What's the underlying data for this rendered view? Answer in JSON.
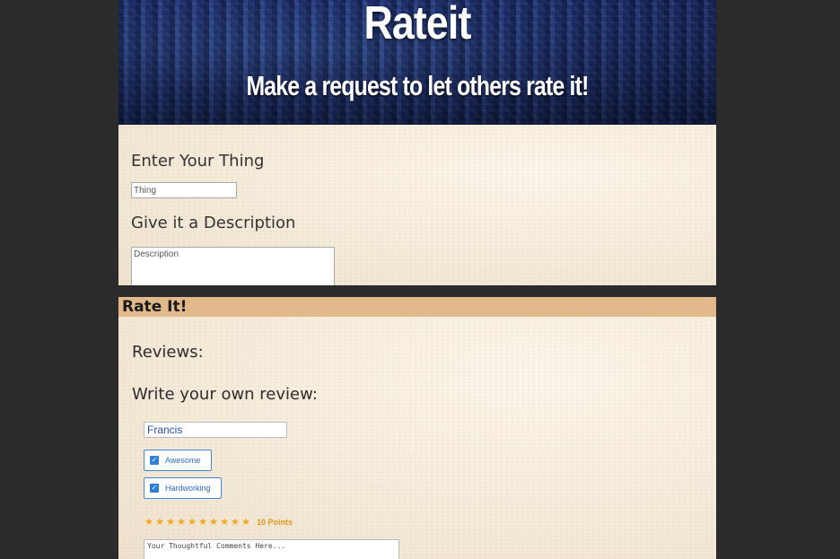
{
  "header": {
    "title": "Rateit",
    "subtitle": "Make a request to let others rate it!"
  },
  "request_form": {
    "thing_label": "Enter Your Thing",
    "thing_placeholder": "Thing",
    "thing_value": "",
    "description_label": "Give it a Description",
    "description_placeholder": "Description",
    "description_value": ""
  },
  "rate_section": {
    "header": "Rate It!",
    "reviews_label": "Reviews:",
    "write_review_label": "Write your own review:",
    "name_value": "Francis",
    "tags": [
      {
        "label": "Awesome",
        "checked": true
      },
      {
        "label": "Hardworking",
        "checked": true
      }
    ],
    "rating": {
      "stars": 10,
      "max_stars": 10,
      "points_label": "10 Points"
    },
    "comments_placeholder": "Your Thoughtful Comments Here...",
    "comments_value": ""
  },
  "colors": {
    "background": "#2b2b2b",
    "rate_header_bg": "#e2b98a",
    "tag_border": "#3f87d4",
    "star": "#f0a81e"
  },
  "icons": {
    "check": "checkbox-checked-icon",
    "star": "star-icon"
  }
}
